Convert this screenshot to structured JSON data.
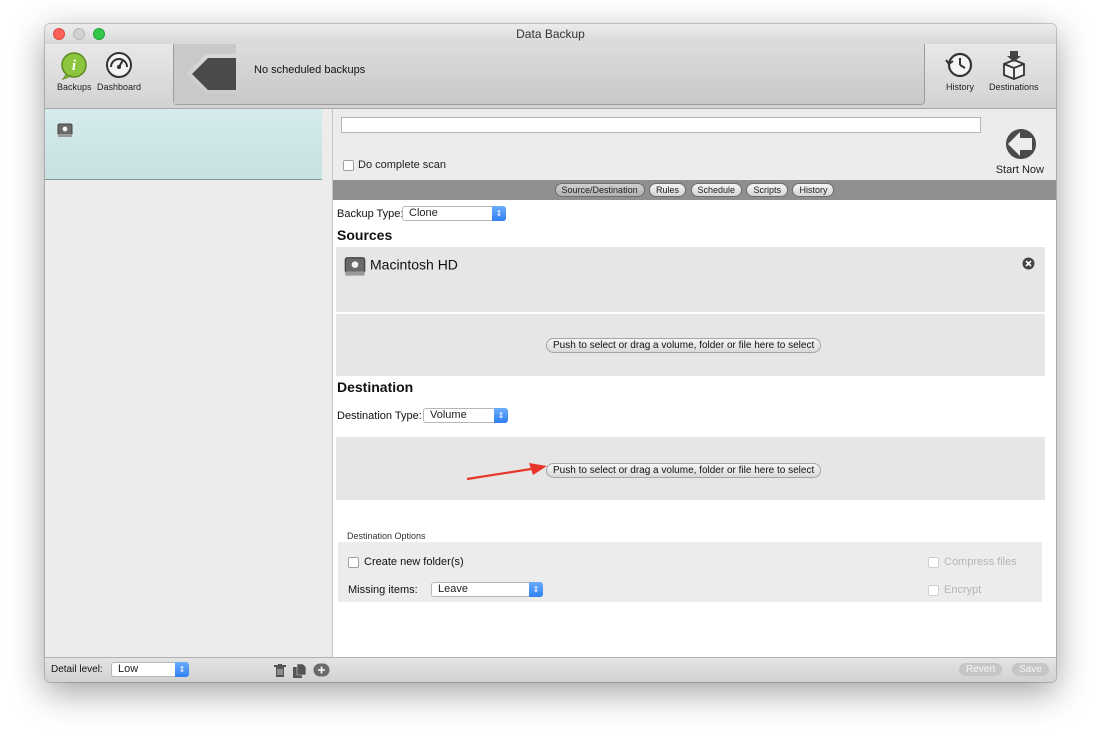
{
  "window": {
    "title": "Data Backup"
  },
  "toolbar": {
    "backups_label": "Backups",
    "dashboard_label": "Dashboard",
    "status_message": "No scheduled backups",
    "history_label": "History",
    "destinations_label": "Destinations"
  },
  "top": {
    "name_value": "",
    "complete_scan_label": "Do complete scan",
    "start_now_label": "Start Now"
  },
  "tabs": [
    "Source/Destination",
    "Rules",
    "Schedule",
    "Scripts",
    "History"
  ],
  "backup_type": {
    "label": "Backup Type:",
    "value": "Clone"
  },
  "sources": {
    "title": "Sources",
    "items": [
      {
        "name": "Macintosh HD"
      }
    ],
    "select_button": "Push to select or drag a volume, folder or file here to select"
  },
  "destination": {
    "title": "Destination",
    "type_label": "Destination Type:",
    "type_value": "Volume",
    "select_button": "Push to select or drag a volume, folder or file here to select"
  },
  "destination_options": {
    "label": "Destination Options",
    "create_folder": "Create new folder(s)",
    "missing_items_label": "Missing items:",
    "missing_items_value": "Leave",
    "compress_files": "Compress files",
    "encrypt": "Encrypt"
  },
  "bottom": {
    "detail_level_label": "Detail level:",
    "detail_level_value": "Low",
    "revert_label": "Revert",
    "save_label": "Save"
  },
  "colors": {
    "accent_blue": "#2f7ff3",
    "selection": "#d6ecec",
    "annotation_arrow": "#e8362b",
    "backups_icon": "#7ab82d"
  },
  "icons": [
    "backups-icon",
    "dashboard-icon",
    "back-arrow-icon",
    "history-icon",
    "destinations-icon",
    "volume-icon",
    "remove-icon",
    "start-now-icon",
    "trash-icon",
    "duplicate-icon",
    "add-icon"
  ]
}
